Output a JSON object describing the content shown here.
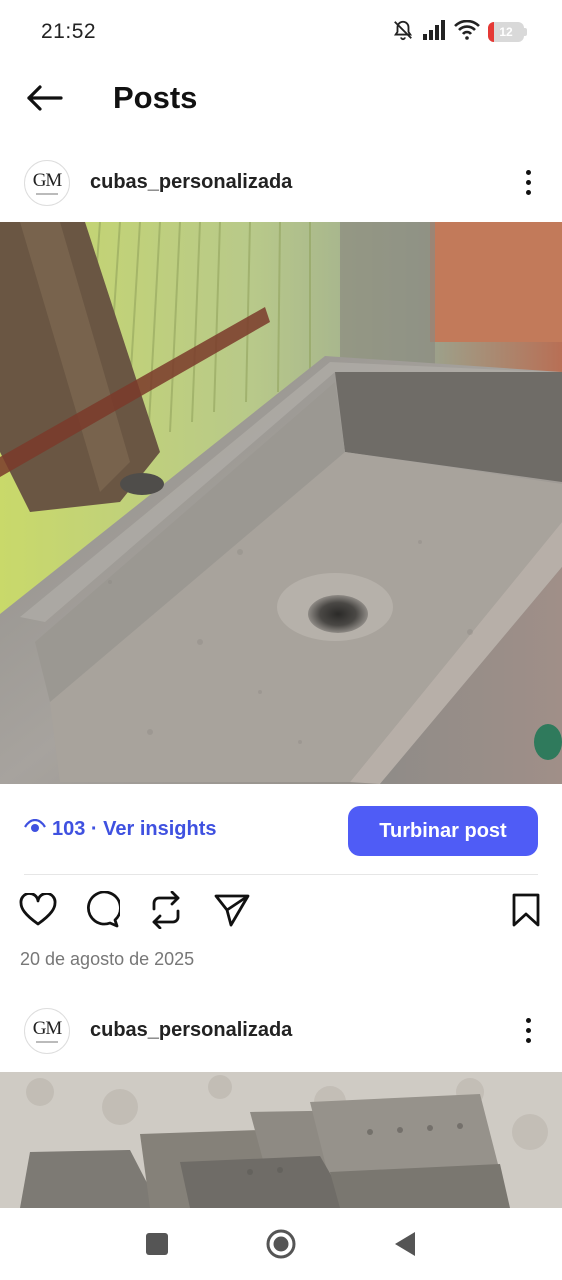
{
  "status_bar": {
    "time": "21:52",
    "battery": "12",
    "icons": [
      "bell-off-icon",
      "signal-icon",
      "wifi-icon",
      "battery-icon"
    ]
  },
  "header": {
    "title": "Posts",
    "back_icon": "back-arrow-icon"
  },
  "posts": [
    {
      "username": "cubas_personalizada",
      "avatar_text": "GM",
      "views": "103",
      "insights_label": "103 · Ver insights",
      "boost_label": "Turbinar post",
      "date": "20 de agosto de 2025",
      "action_icons": [
        "heart-icon",
        "comment-icon",
        "repost-icon",
        "share-icon",
        "bookmark-icon"
      ]
    },
    {
      "username": "cubas_personalizada",
      "avatar_text": "GM"
    }
  ],
  "colors": {
    "accent": "#4f5cf6",
    "link": "#3f51e0"
  }
}
